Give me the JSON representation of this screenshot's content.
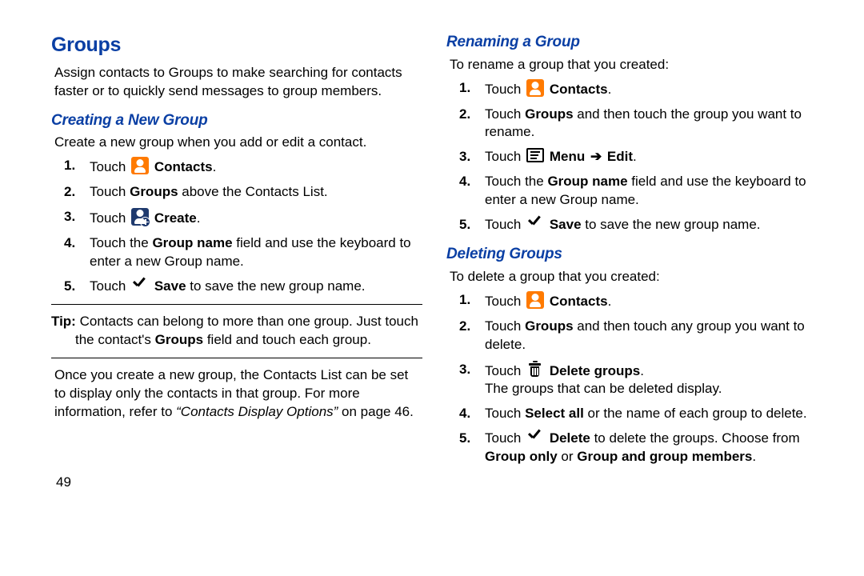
{
  "left": {
    "section_title": "Groups",
    "section_intro": "Assign contacts to Groups to make searching for contacts faster or to quickly send messages to group members.",
    "sub1_title": "Creating a New Group",
    "sub1_lead": "Create a new group when you add or edit a contact.",
    "steps1": {
      "s1a": "Touch ",
      "s1b": "Contacts",
      "s1c": ".",
      "s2a": "Touch ",
      "s2b": "Groups",
      "s2c": " above the Contacts List.",
      "s3a": "Touch ",
      "s3b": "Create",
      "s3c": ".",
      "s4a": "Touch the ",
      "s4b": "Group name",
      "s4c": " field and use the keyboard to enter a new Group name.",
      "s5a": "Touch ",
      "s5b": "Save",
      "s5c": " to save the new group name."
    },
    "tip_label": "Tip:",
    "tip_rest1": " Contacts can belong to more than one group. Just touch",
    "tip_rest2": "the contact's ",
    "tip_bold": "Groups",
    "tip_rest3": " field and touch each group.",
    "para2a": "Once you create a new group, the Contacts List can be set to display only the contacts in that group. For more information, refer to ",
    "para2ref": "“Contacts Display Options”",
    "para2b": " on page 46."
  },
  "right": {
    "sub2_title": "Renaming a Group",
    "sub2_lead": "To rename a group that you created:",
    "steps2": {
      "s1a": "Touch ",
      "s1b": "Contacts",
      "s1c": ".",
      "s2a": "Touch ",
      "s2b": "Groups",
      "s2c": " and then touch the group you want to rename.",
      "s3a": "Touch ",
      "s3b": "Menu",
      "s3arrow": " ➔ ",
      "s3c": "Edit",
      "s3d": ".",
      "s4a": "Touch the ",
      "s4b": "Group name",
      "s4c": " field and use the keyboard to enter a new Group name.",
      "s5a": "Touch ",
      "s5b": "Save",
      "s5c": " to save the new group name."
    },
    "sub3_title": "Deleting Groups",
    "sub3_lead": "To delete a group that you created:",
    "steps3": {
      "s1a": "Touch ",
      "s1b": "Contacts",
      "s1c": ".",
      "s2a": "Touch ",
      "s2b": "Groups",
      "s2c": " and then touch any group you want to delete.",
      "s3a": "Touch ",
      "s3b": "Delete groups",
      "s3c": ".",
      "s3line2": "The groups that can be deleted display.",
      "s4a": "Touch ",
      "s4b": "Select all",
      "s4c": " or the name of each group to delete.",
      "s5a": "Touch ",
      "s5b": "Delete",
      "s5c": " to delete the groups. Choose from ",
      "s5d": "Group only",
      "s5e": " or ",
      "s5f": "Group and group members",
      "s5g": "."
    }
  },
  "page_number": "49"
}
